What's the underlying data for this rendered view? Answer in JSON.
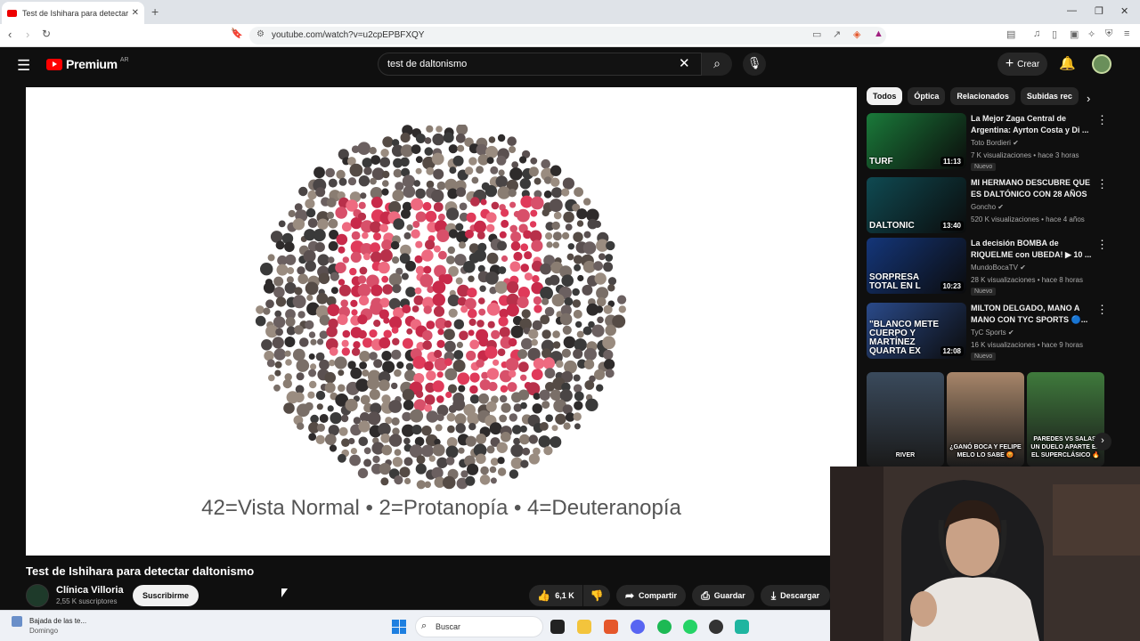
{
  "browser": {
    "tab_title": "Test de Ishihara para detectar daltonismo - YouTube",
    "url": "youtube.com/watch?v=u2cpEPBFXQY",
    "new_tab": "+",
    "tab_close": "✕"
  },
  "header": {
    "brand": "Premium",
    "country": "AR",
    "search_value": "test de daltonismo",
    "create_label": "Crear"
  },
  "video": {
    "plate_caption": "42=Vista Normal • 2=Protanopía • 4=Deuteranopía",
    "title": "Test de Ishihara para detectar daltonismo",
    "channel": "Clínica Villoria",
    "subscribers": "2,55 K suscriptores",
    "subscribe_label": "Suscribirme",
    "likes": "6,1 K",
    "share_label": "Compartir",
    "save_label": "Guardar",
    "download_label": "Descargar"
  },
  "chips": [
    "Todos",
    "Óptica",
    "Relacionados",
    "Subidas rec"
  ],
  "recommendations": [
    {
      "title": "La Mejor Zaga Central de Argentina: Ayrton Costa y Di ...",
      "channel": "Toto Bordieri",
      "meta": "7 K visualizaciones • hace 3 horas",
      "badge": "Nuevo",
      "duration": "11:13",
      "thumb_text": "TURF",
      "thumb_color": "#1a7a3a"
    },
    {
      "title": "MI HERMANO DESCUBRE QUE ES DALTÓNICO CON 28 AÑOS",
      "channel": "Goncho",
      "meta": "520 K visualizaciones • hace 4 años",
      "badge": "",
      "duration": "13:40",
      "thumb_text": "DALTONIC",
      "thumb_color": "#0f4a52"
    },
    {
      "title": "La decisión BOMBA de RIQUELME con UBEDA! ▶ 10 ...",
      "channel": "MundoBocaTV",
      "meta": "28 K visualizaciones • hace 8 horas",
      "badge": "Nuevo",
      "duration": "10:23",
      "thumb_text": "SORPRESA TOTAL EN L",
      "thumb_color": "#14367a"
    },
    {
      "title": "MILTON DELGADO, MANO A MANO CON TYC SPORTS 🔵...",
      "channel": "TyC Sports",
      "meta": "16 K visualizaciones • hace 9 horas",
      "badge": "Nuevo",
      "duration": "12:08",
      "thumb_text": "\"BLANCO METE CUERPO Y MARTÍNEZ QUARTA EX",
      "thumb_color": "#2a4a8a"
    }
  ],
  "shorts": [
    {
      "caption": "RIVER",
      "color": "#3a4a5c"
    },
    {
      "caption": "¿GANÓ BOCA Y FELIPE MELO LO SABE 😡",
      "color": "#a8866a"
    },
    {
      "caption": "PAREDES VS SALAS, UN DUELO APARTE EN EL SUPERCLÁSICO 🔥",
      "color": "#3f7a3c"
    }
  ],
  "taskbar": {
    "notif_title": "Bajada de las te...",
    "notif_sub": "Domingo",
    "search_placeholder": "Buscar"
  },
  "colors": {
    "accent_red": "#ff0000",
    "dark_bg": "#0f0f0f"
  }
}
